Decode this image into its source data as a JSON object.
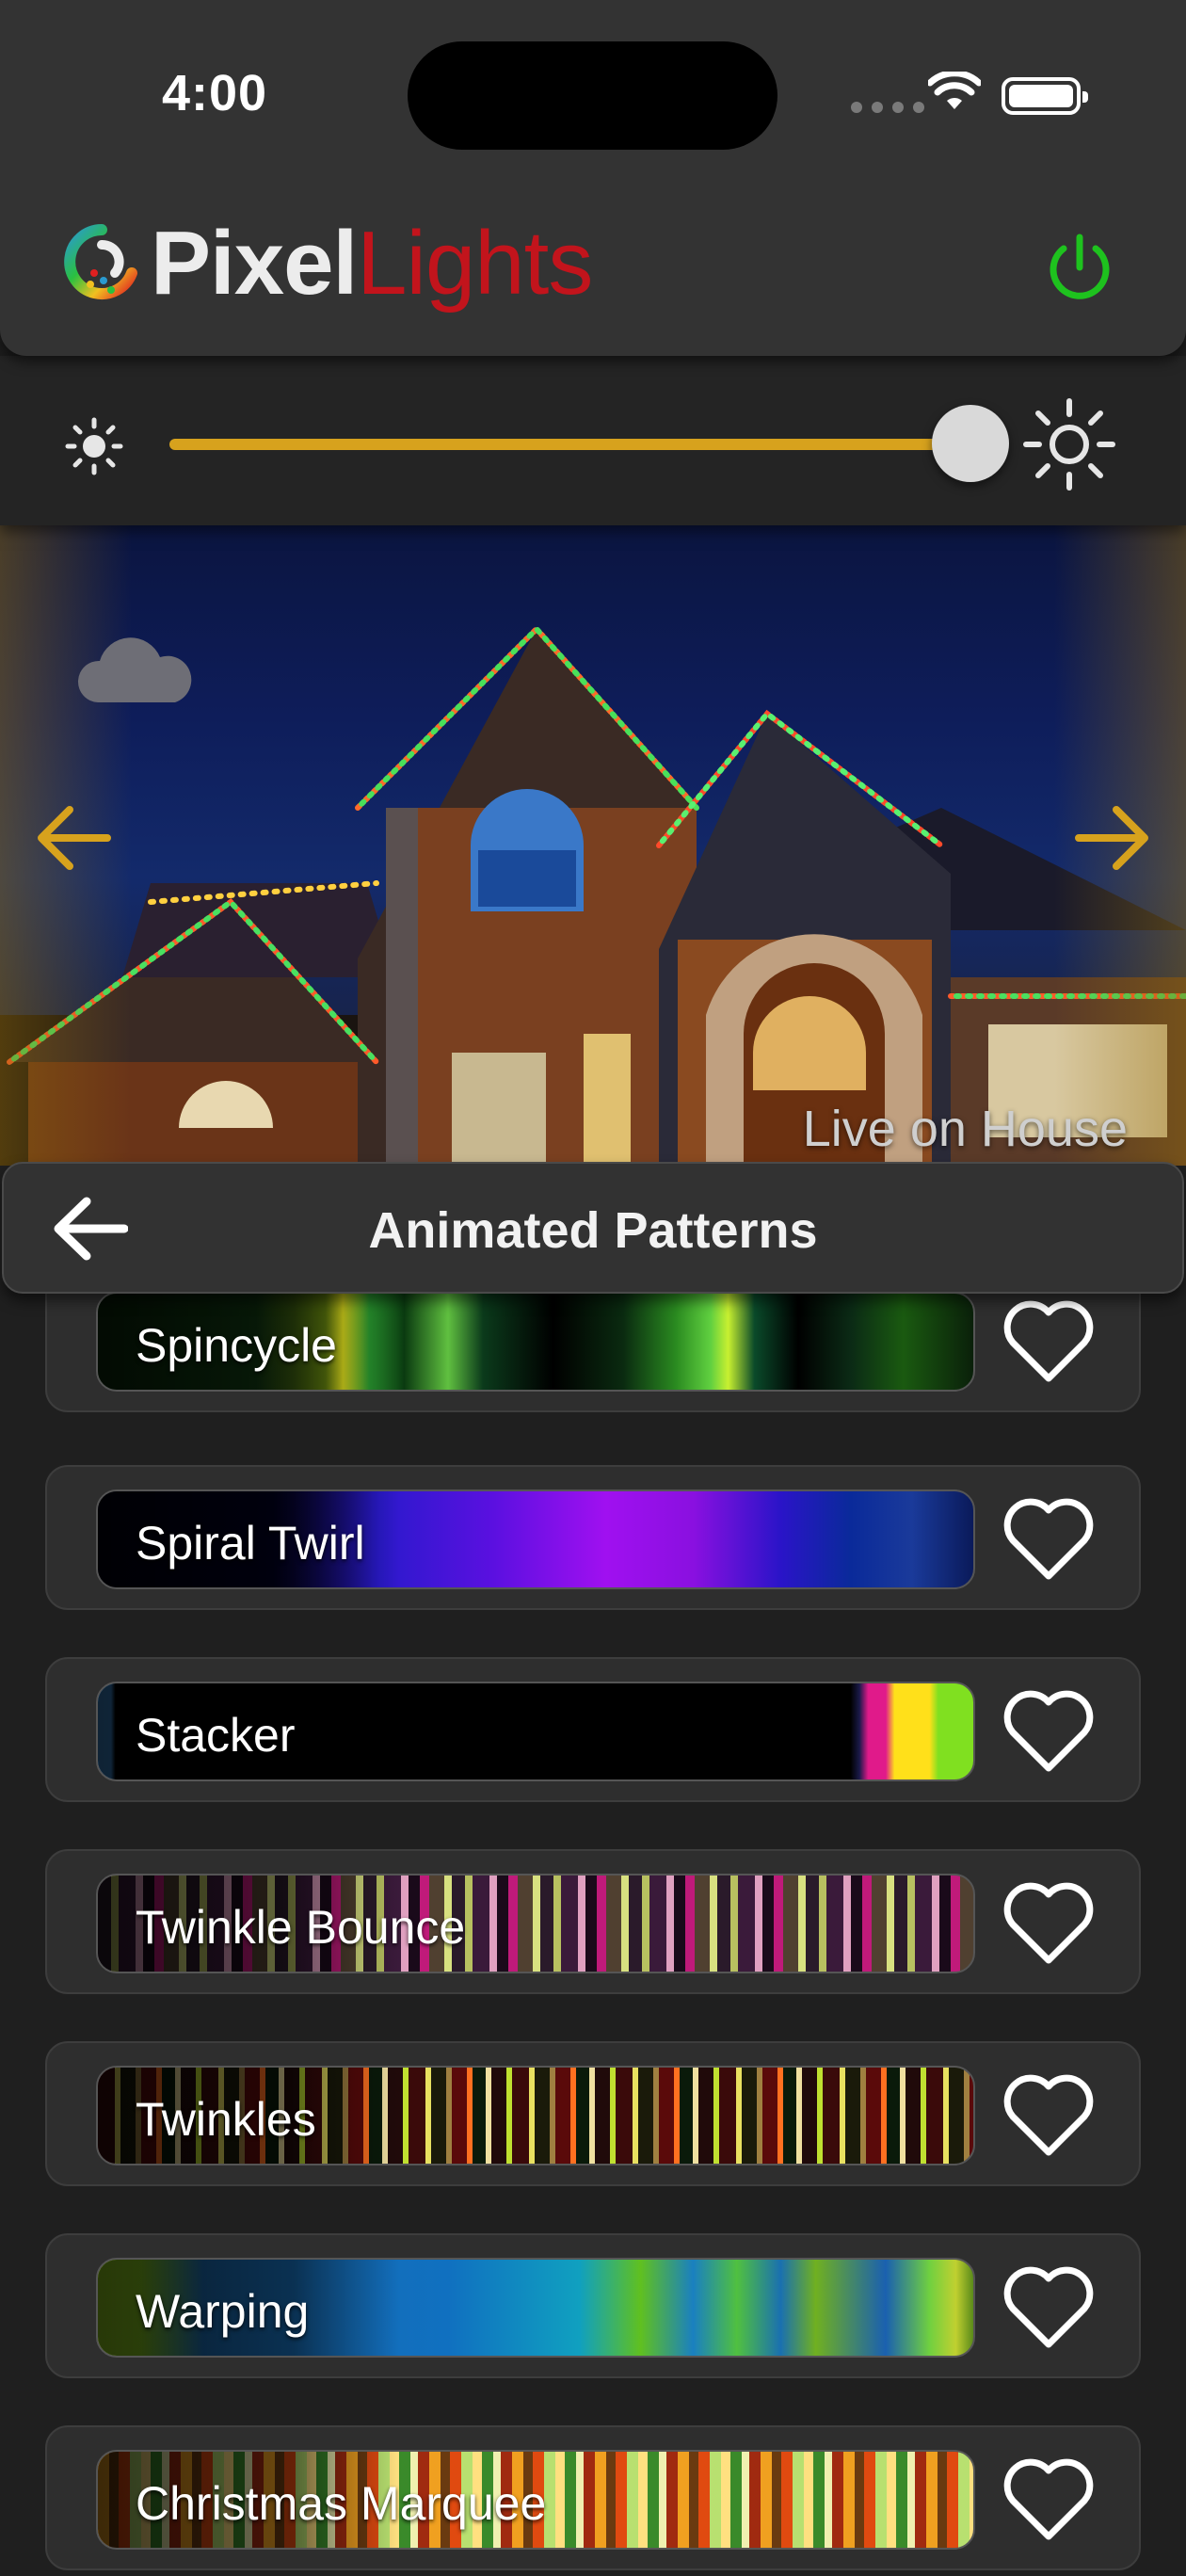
{
  "status_bar": {
    "time": "4:00",
    "icons": [
      "cellular-signal-icon",
      "wifi-icon",
      "battery-icon"
    ]
  },
  "header": {
    "logo_text_primary": "Pixel",
    "logo_text_secondary": "Lights",
    "power_icon": "power-icon",
    "colors": {
      "power": "#1ec21e",
      "logo_primary": "#ececec",
      "logo_secondary": "#c2141c"
    }
  },
  "brightness": {
    "level_fraction": 0.95,
    "min_icon": "sun-dim-icon",
    "max_icon": "sun-bright-icon",
    "track_color": "#d7a21d"
  },
  "preview": {
    "live_label": "Live on House",
    "weather_icon": "cloud-icon",
    "prev_icon": "arrow-left-icon",
    "next_icon": "arrow-right-icon",
    "arrow_color": "#d7a21d"
  },
  "section": {
    "title": "Animated Patterns",
    "back_icon": "back-arrow-icon"
  },
  "patterns": [
    {
      "name": "Spincycle",
      "favorite": false
    },
    {
      "name": "Spiral Twirl",
      "favorite": false
    },
    {
      "name": "Stacker",
      "favorite": false
    },
    {
      "name": "Twinkle Bounce",
      "favorite": false
    },
    {
      "name": "Twinkles",
      "favorite": false
    },
    {
      "name": "Warping",
      "favorite": false
    },
    {
      "name": "Christmas Marquee",
      "favorite": false
    }
  ]
}
